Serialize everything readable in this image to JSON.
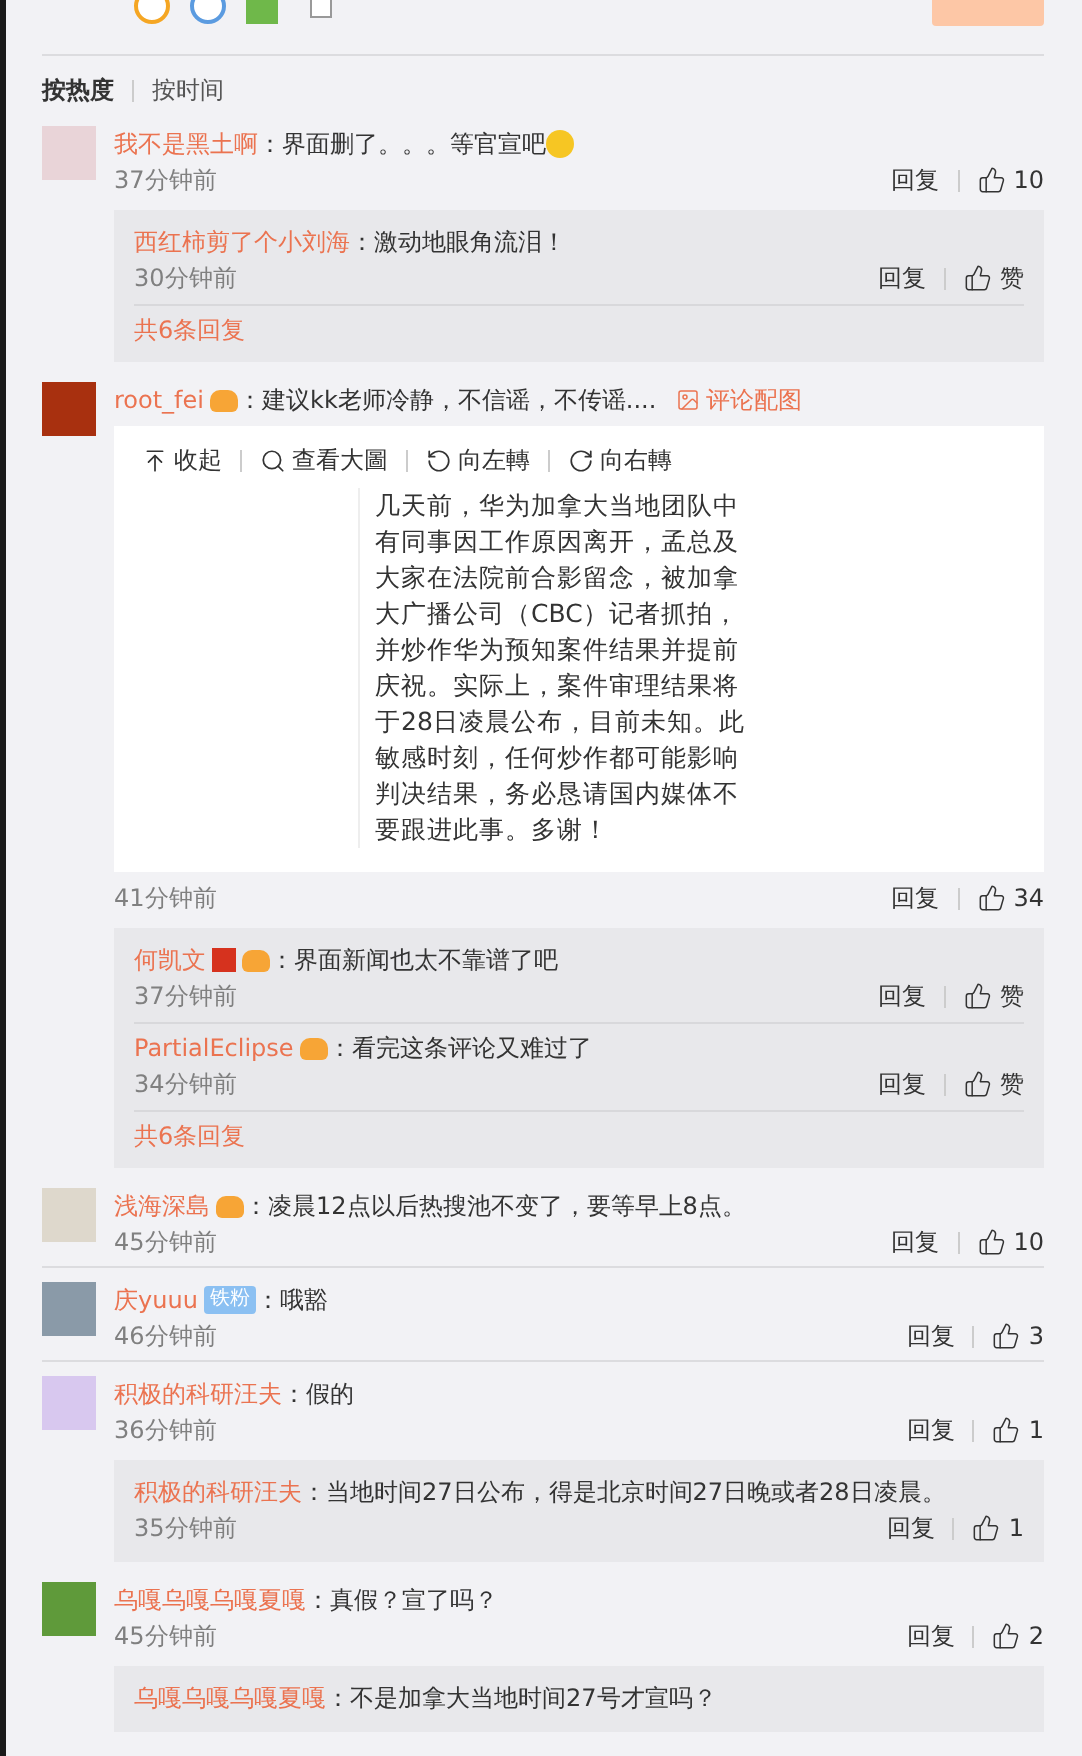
{
  "composer": {
    "repost_checkbox": {
      "checked": false
    }
  },
  "sort_tabs": [
    {
      "label": "按热度",
      "selected": true
    },
    {
      "label": "按时间",
      "selected": false
    }
  ],
  "comments": [
    {
      "user": "我不是黑土啊",
      "text": "：界面删了。。。等官宣吧",
      "emoji": true,
      "time": "37分钟前",
      "reply": "回复",
      "likes": "10",
      "replies": [
        {
          "user": "西红柿剪了个小刘海",
          "text": "：激动地眼角流泪！",
          "time": "30分钟前",
          "reply": "回复",
          "likes": "赞"
        }
      ],
      "more": "共6条回复"
    },
    {
      "user": "root_fei",
      "badges": [
        {
          "kind": "member"
        }
      ],
      "text": "：建议kk老师冷静，不信谣，不传谣....",
      "attachment_link": "评论配图",
      "emoji": false,
      "image": {
        "toolbar": [
          "收起",
          "查看大圖",
          "向左轉",
          "向右轉"
        ],
        "lines": [
          "几天前，华为加拿大当地团队中",
          "有同事因工作原因离开，孟总及",
          "大家在法院前合影留念，被加拿",
          "大广播公司（CBC）记者抓拍，",
          "并炒作华为预知案件结果并提前",
          "庆祝。实际上，案件审理结果将",
          "于28日凌晨公布，目前未知。此",
          "敏感时刻，任何炒作都可能影响",
          "判决结果，务必恳请国内媒体不",
          "要跟进此事。多谢！"
        ]
      },
      "time": "41分钟前",
      "reply": "回复",
      "likes": "34",
      "replies": [
        {
          "user": "何凯文",
          "badges": [
            {
              "kind": "verified"
            },
            {
              "kind": "member"
            }
          ],
          "text": "：界面新闻也太不靠谱了吧",
          "time": "37分钟前",
          "reply": "回复",
          "likes": "赞"
        },
        {
          "user": "PartialEclipse",
          "badges": [
            {
              "kind": "member"
            }
          ],
          "text": "：看完这条评论又难过了",
          "time": "34分钟前",
          "reply": "回复",
          "likes": "赞"
        }
      ],
      "more": "共6条回复"
    },
    {
      "user": "浅海深島",
      "badges": [
        {
          "kind": "member"
        }
      ],
      "text": "：凌晨12点以后热搜池不变了，要等早上8点。",
      "emoji": false,
      "time": "45分钟前",
      "reply": "回复",
      "likes": "10"
    },
    {
      "user": "庆yuuu",
      "badges": [
        {
          "kind": "tag",
          "text": "铁粉"
        }
      ],
      "text": "：哦豁",
      "emoji": false,
      "time": "46分钟前",
      "reply": "回复",
      "likes": "3"
    },
    {
      "user": "积极的科研汪夫",
      "text": "：假的",
      "emoji": false,
      "time": "36分钟前",
      "reply": "回复",
      "likes": "1",
      "replies": [
        {
          "user": "积极的科研汪夫",
          "text": "：当地时间27日公布，得是北京时间27日晚或者28日凌晨。",
          "time": "35分钟前",
          "reply": "回复",
          "likes": "1"
        }
      ]
    },
    {
      "user": "乌嘎乌嘎乌嘎夏嘎",
      "text": "：真假？宣了吗？",
      "emoji": false,
      "time": "45分钟前",
      "reply": "回复",
      "likes": "2",
      "replies": [
        {
          "user": "乌嘎乌嘎乌嘎夏嘎",
          "text": "：不是加拿大当地时间27号才宣吗？"
        }
      ]
    }
  ]
}
